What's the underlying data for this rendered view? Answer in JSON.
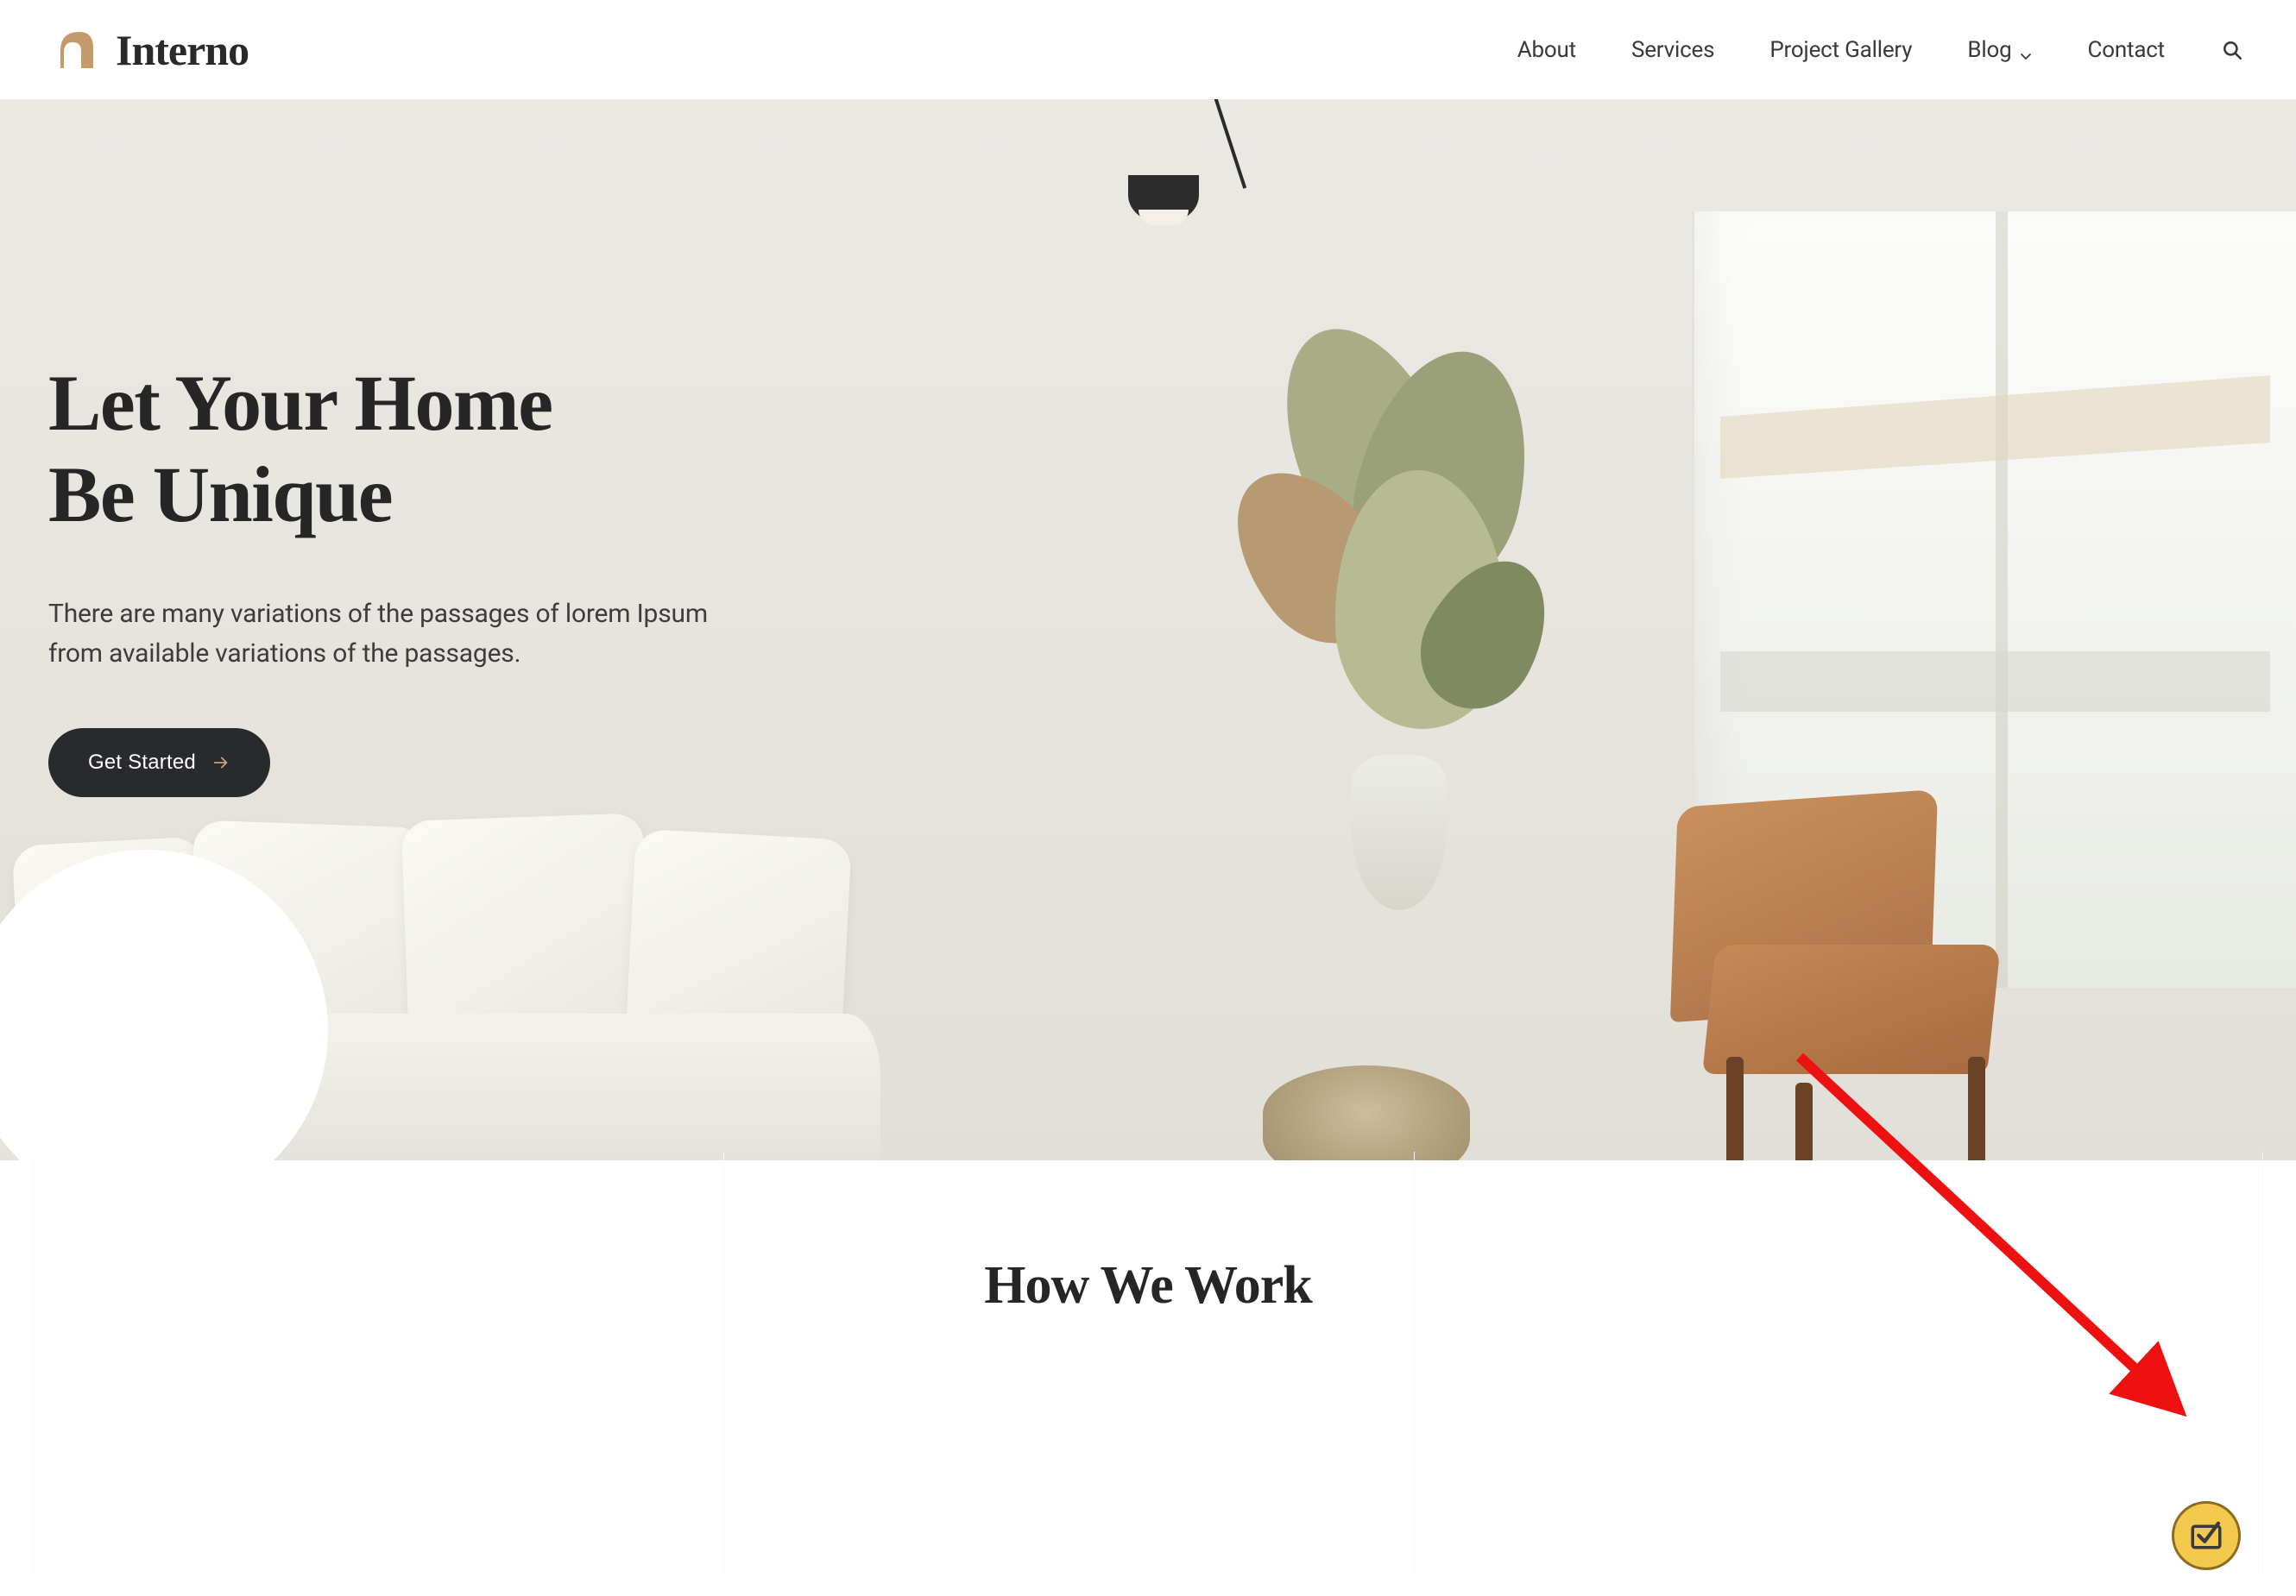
{
  "brand": {
    "name": "Interno"
  },
  "nav": {
    "items": [
      {
        "label": "About"
      },
      {
        "label": "Services"
      },
      {
        "label": "Project Gallery"
      },
      {
        "label": "Blog",
        "dropdown": true
      },
      {
        "label": "Contact"
      }
    ]
  },
  "hero": {
    "title_line1": "Let Your Home",
    "title_line2": "Be Unique",
    "subtitle": "There are many variations of the passages of lorem Ipsum from available variations of the passages.",
    "cta_label": "Get Started"
  },
  "section": {
    "title": "How We Work"
  },
  "colors": {
    "accent_tan": "#c49a6c",
    "dark": "#282a2e",
    "badge_yellow": "#f2c94c"
  }
}
